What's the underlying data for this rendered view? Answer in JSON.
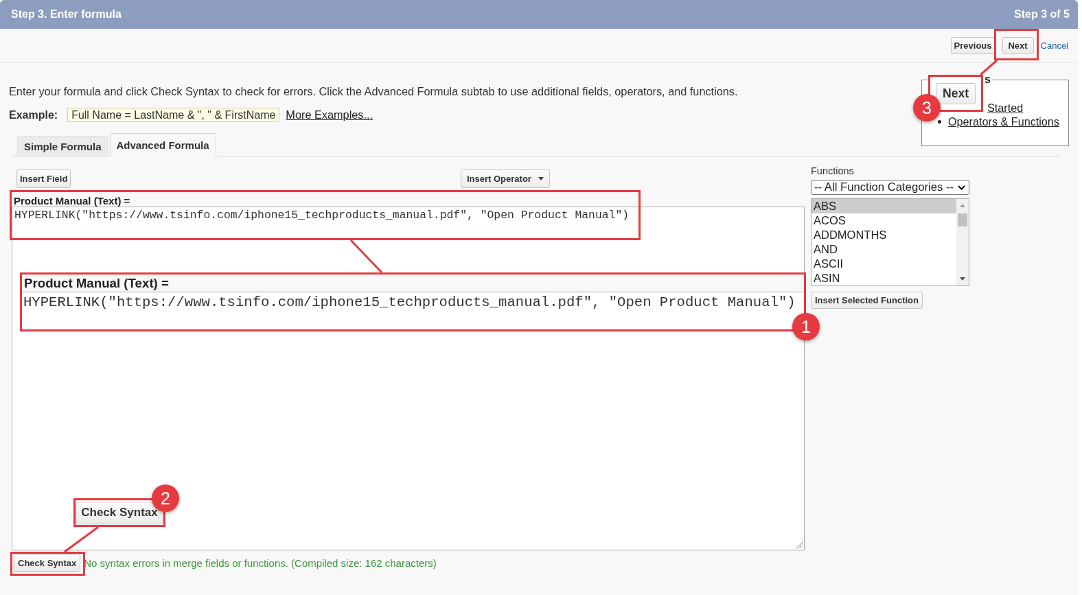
{
  "header": {
    "title": "Step 3. Enter formula",
    "progress": "Step 3 of 5"
  },
  "toolbar": {
    "buttons": [
      "Previous",
      "Next"
    ],
    "cancel": "Cancel"
  },
  "intro": {
    "instructions": "Enter your formula and click Check Syntax to check for errors. Click the Advanced Formula subtab to use additional fields, operators, and functions.",
    "example_label": "Example:",
    "example_value": "Full Name = LastName & \", \" & FirstName",
    "example_link": "More Examples..."
  },
  "help_box": {
    "title": "s",
    "links": [
      {
        "label": "Started",
        "bullet": false
      },
      {
        "label": "Operators & Functions",
        "bullet": true
      }
    ]
  },
  "tabs": [
    {
      "label": "Simple Formula",
      "selected": false
    },
    {
      "label": "Advanced Formula",
      "selected": true
    }
  ],
  "editor": {
    "buttons": [
      "Insert Field",
      "Insert Operator"
    ],
    "field_label": "Product Manual (Text) =",
    "formula": "HYPERLINK(\"https://www.tsinfo.com/iphone15_techproducts_manual.pdf\", \"Open Product Manual\")",
    "check_button": "Check Syntax",
    "message": "No syntax errors in merge fields or functions. (Compiled size: 162 characters)"
  },
  "functions": {
    "label": "Functions",
    "category": "-- All Function Categories --",
    "items": [
      {
        "name": "ABS",
        "selected": true
      },
      {
        "name": "ACOS",
        "selected": false
      },
      {
        "name": "ADDMONTHS",
        "selected": false
      },
      {
        "name": "AND",
        "selected": false
      },
      {
        "name": "ASCII",
        "selected": false
      },
      {
        "name": "ASIN",
        "selected": false
      }
    ],
    "insert_button": "Insert Selected Function"
  },
  "annotations": [
    {
      "number": "3",
      "kind": "button",
      "label": "Next"
    },
    {
      "number": "1",
      "kind": "field",
      "title": "Product Manual (Text) =",
      "formula": "HYPERLINK(\"https://www.tsinfo.com/iphone15_techproducts_manual.pdf\", \"Open Product Manual\")"
    },
    {
      "number": "2",
      "kind": "button",
      "label": "Check Syntax"
    }
  ]
}
